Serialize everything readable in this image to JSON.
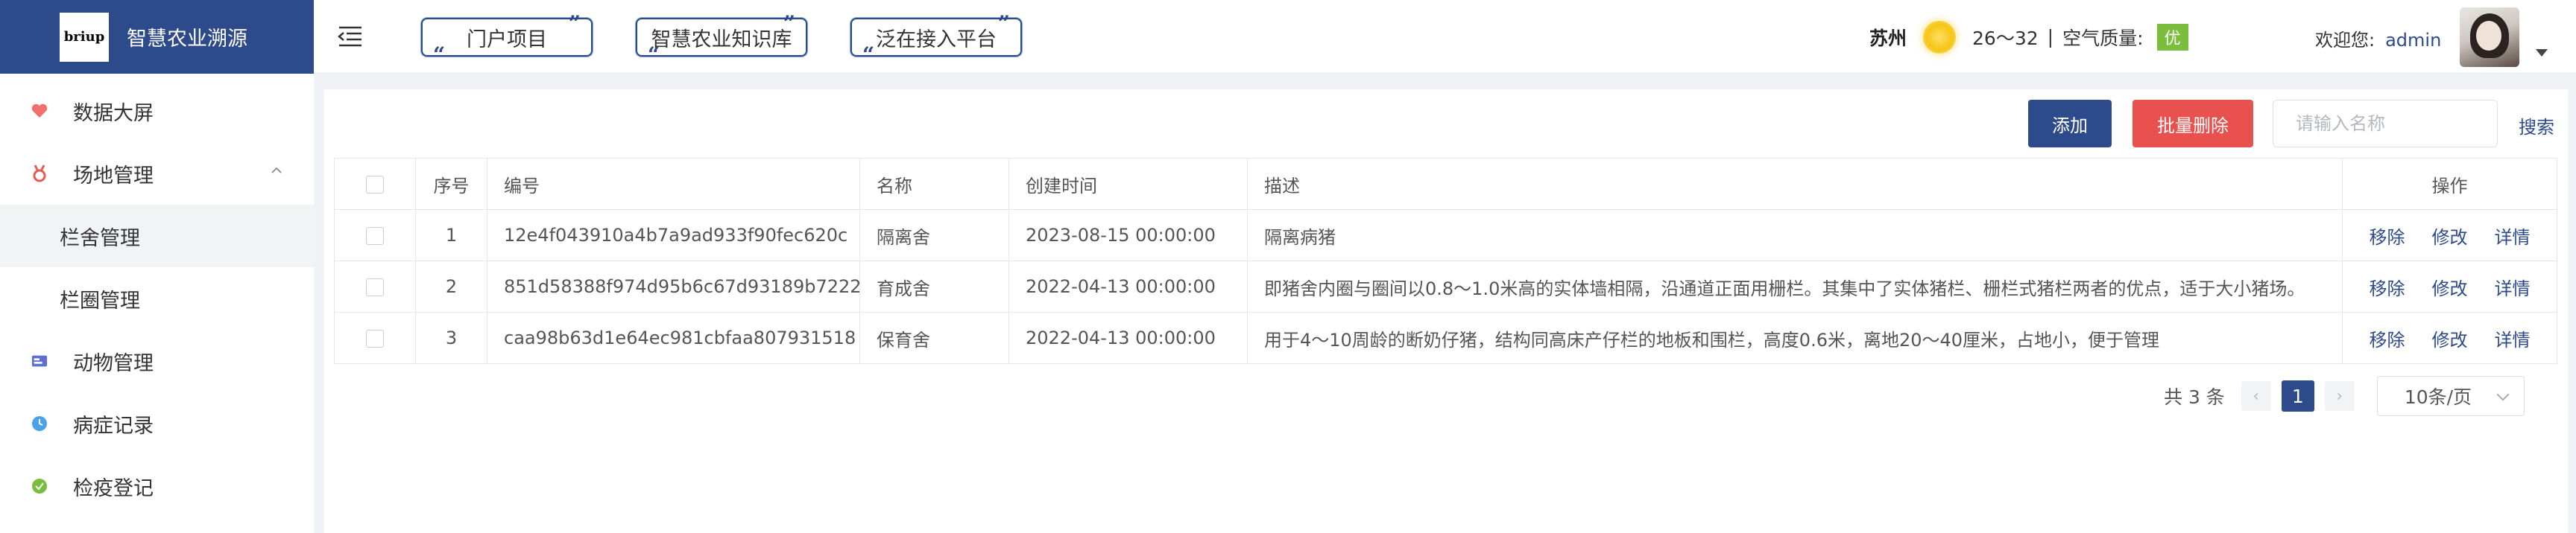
{
  "app": {
    "logo_text": "briup",
    "title": "智慧农业溯源"
  },
  "sidebar": {
    "items": [
      {
        "label": "数据大屏",
        "icon": "heart-icon",
        "color": "#f07070"
      },
      {
        "label": "场地管理",
        "icon": "medal-icon",
        "color": "#e85a4f",
        "expanded": true
      },
      {
        "label": "栏舍管理",
        "active": true
      },
      {
        "label": "栏圈管理"
      },
      {
        "label": "动物管理",
        "icon": "card-icon",
        "color": "#5b6fd6"
      },
      {
        "label": "病症记录",
        "icon": "clock-icon",
        "color": "#4aa3e8"
      },
      {
        "label": "检疫登记",
        "icon": "check-circle-icon",
        "color": "#7bbd3c"
      }
    ]
  },
  "header": {
    "tabs": [
      "门户项目",
      "智慧农业知识库",
      "泛在接入平台"
    ],
    "weather": {
      "city": "苏州",
      "temp": "26～32",
      "divider": "|",
      "aq_label": "空气质量:",
      "aq_value": "优"
    },
    "welcome": "欢迎您:",
    "username": "admin"
  },
  "toolbar": {
    "add_label": "添加",
    "batch_delete_label": "批量删除",
    "search_placeholder": "请输入名称",
    "search_label": "搜索"
  },
  "table": {
    "headers": [
      "序号",
      "编号",
      "名称",
      "创建时间",
      "描述",
      "操作"
    ],
    "rows": [
      {
        "index": "1",
        "code": "12e4f043910a4b7a9ad933f90fec620c",
        "name": "隔离舍",
        "created": "2023-08-15 00:00:00",
        "desc": "隔离病猪"
      },
      {
        "index": "2",
        "code": "851d58388f974d95b6c67d93189b7222",
        "name": "育成舍",
        "created": "2022-04-13 00:00:00",
        "desc": "即猪舍内圈与圈间以0.8～1.0米高的实体墙相隔，沿通道正面用栅栏。其集中了实体猪栏、栅栏式猪栏两者的优点，适于大小猪场。"
      },
      {
        "index": "3",
        "code": "caa98b63d1e64ec981cbfaa807931518",
        "name": "保育舍",
        "created": "2022-04-13 00:00:00",
        "desc": "用于4～10周龄的断奶仔猪，结构同高床产仔栏的地板和围栏，高度0.6米，离地20～40厘米，占地小，便于管理"
      }
    ],
    "ops": [
      "移除",
      "修改",
      "详情"
    ]
  },
  "pagination": {
    "total": "共 3 条",
    "prev": "‹",
    "current": "1",
    "next": "›",
    "page_size": "10条/页"
  },
  "colors": {
    "brand": "#2d4a8a",
    "danger": "#e9514f",
    "aq_good": "#7bbd3c"
  }
}
